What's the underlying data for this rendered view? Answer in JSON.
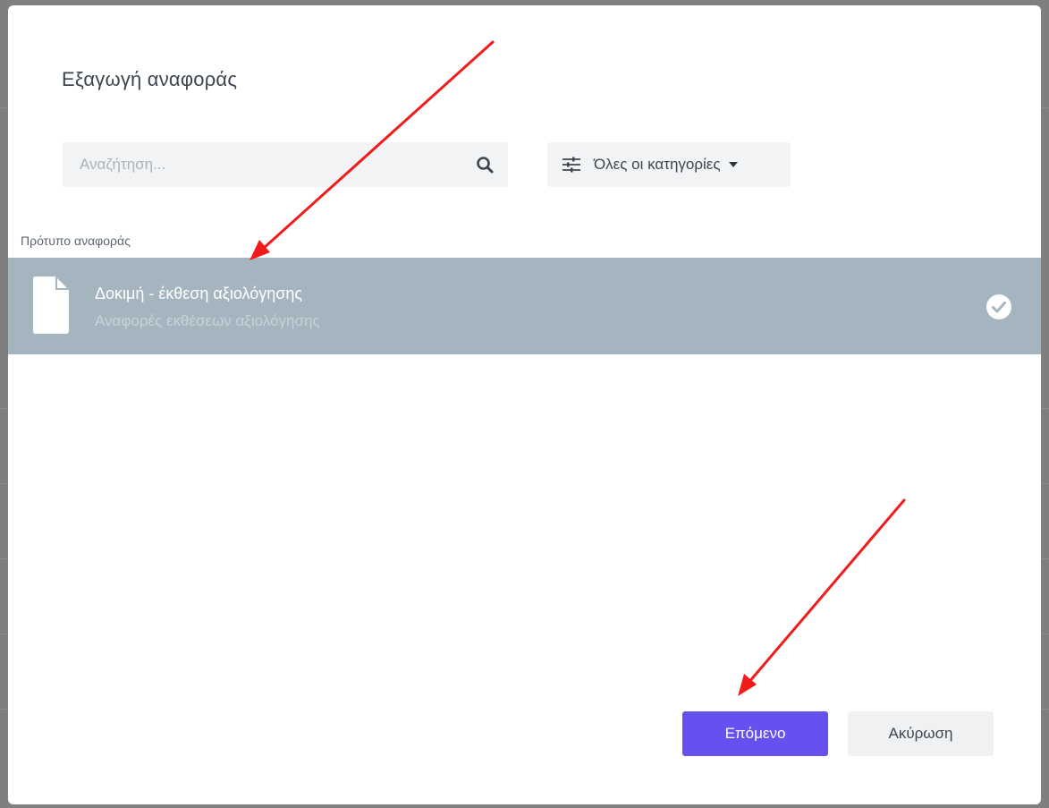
{
  "modal": {
    "title": "Εξαγωγή αναφοράς"
  },
  "search": {
    "placeholder": "Αναζήτηση..."
  },
  "category_filter": {
    "label": "Όλες οι κατηγορίες"
  },
  "templates": {
    "section_label": "Πρότυπο αναφοράς",
    "items": [
      {
        "name": "Δοκιμή - έκθεση αξιολόγησης",
        "category": "Αναφορές εκθέσεων αξιολόγησης",
        "selected": true
      }
    ]
  },
  "footer": {
    "next_label": "Επόμενο",
    "cancel_label": "Ακύρωση"
  },
  "colors": {
    "primary": "#6451f0",
    "selected_row": "#a4b5bf",
    "annotation_arrow": "#f01c1c"
  },
  "icons": [
    "search-icon",
    "filter-icon",
    "caret-down-icon",
    "document-icon",
    "check-circle-icon"
  ]
}
